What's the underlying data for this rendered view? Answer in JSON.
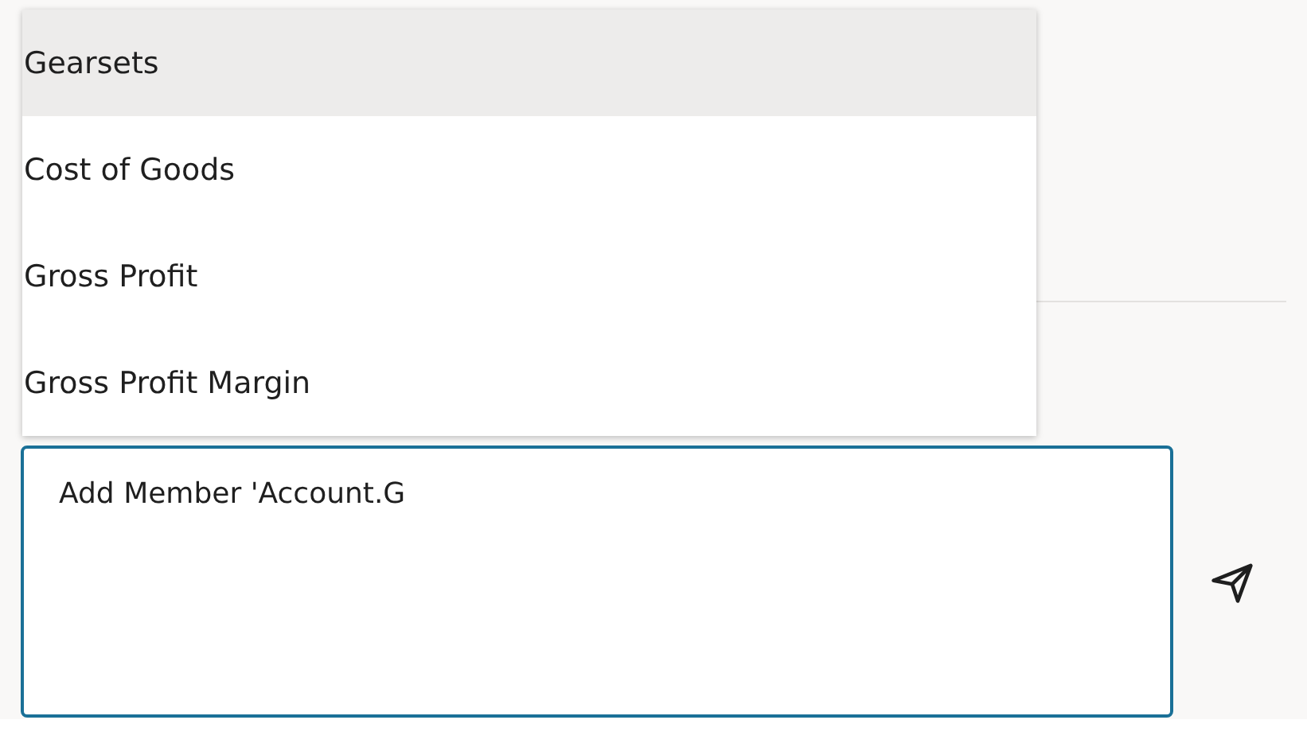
{
  "suggestions": [
    {
      "label": "Gearsets",
      "selected": true
    },
    {
      "label": "Cost of Goods",
      "selected": false
    },
    {
      "label": "Gross Profit",
      "selected": false
    },
    {
      "label": "Gross Profit Margin",
      "selected": false
    }
  ],
  "composer": {
    "value": "Add Member 'Account.G"
  }
}
